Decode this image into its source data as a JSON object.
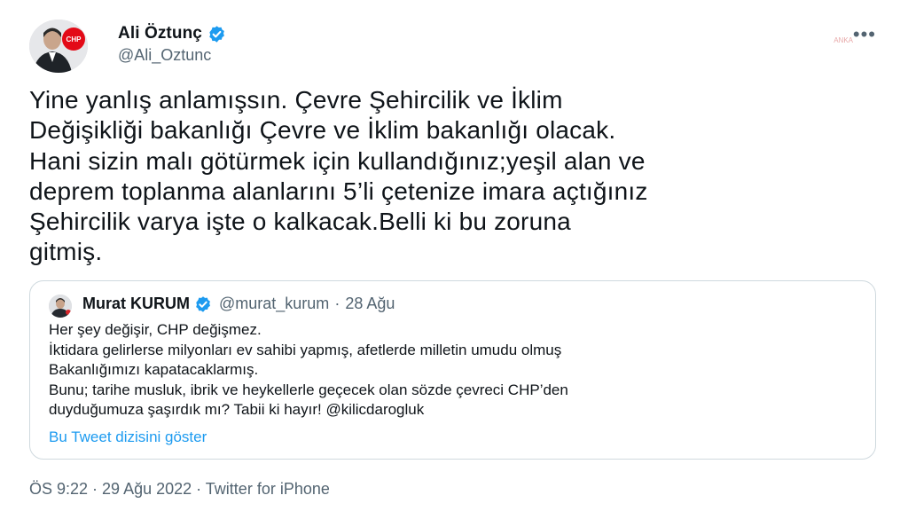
{
  "tweet": {
    "author": {
      "name": "Ali Öztunç",
      "handle": "@Ali_Oztunc",
      "avatar_badge": "CHP"
    },
    "more_icon": "more-horizontal-icon",
    "watermark": "ANKA",
    "text": "Yine yanlış anlamışsın. Çevre Şehircilik ve İklim\nDeğişikliği bakanlığı Çevre ve İklim bakanlığı olacak.\nHani sizin malı götürmek için kullandığınız;yeşil alan ve\ndeprem toplanma alanlarını 5’li çetenize imara açtığınız\nŞehircilik varya işte o kalkacak.Belli ki bu zoruna\ngitmiş.",
    "quoted": {
      "name": "Murat KURUM",
      "handle": "@murat_kurum",
      "date": "28 Ağu",
      "separator": "·",
      "text": "Her şey değişir, CHP değişmez.\nİktidara gelirlerse milyonları ev sahibi yapmış, afetlerde milletin umudu olmuş\nBakanlığımızı kapatacaklarmış.\nBunu; tarihe musluk, ibrik ve heykellerle geçecek olan sözde çevreci CHP’den\nduyduğumuza şaşırdık mı? Tabii ki hayır! @kilicdarogluk",
      "thread_link": "Bu Tweet dizisini göster"
    },
    "timestamp": "ÖS 9:22 · 29 Ağu 2022 · Twitter for iPhone"
  },
  "colors": {
    "verified": "#1d9bf0",
    "link": "#1d9bf0",
    "secondary_text": "#536471",
    "border": "#cfd9de",
    "chp_red": "#e30a17"
  }
}
